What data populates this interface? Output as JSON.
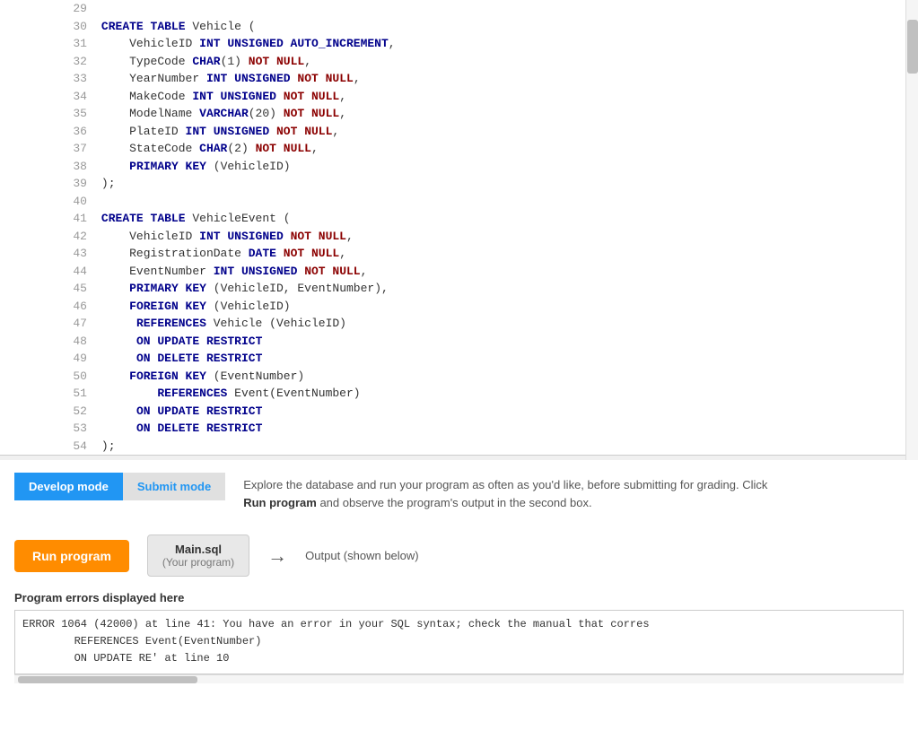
{
  "editor": {
    "lines": [
      {
        "num": 29,
        "code": ""
      },
      {
        "num": 30,
        "tokens": [
          {
            "t": "kw",
            "v": "CREATE TABLE"
          },
          {
            "t": "plain",
            "v": " Vehicle ("
          }
        ]
      },
      {
        "num": 31,
        "tokens": [
          {
            "t": "plain",
            "v": "    VehicleID "
          },
          {
            "t": "kw",
            "v": "INT UNSIGNED AUTO_INCREMENT"
          },
          {
            "t": "plain",
            "v": ","
          }
        ]
      },
      {
        "num": 32,
        "tokens": [
          {
            "t": "plain",
            "v": "    TypeCode "
          },
          {
            "t": "kw",
            "v": "CHAR"
          },
          {
            "t": "plain",
            "v": "(1) "
          },
          {
            "t": "kw2",
            "v": "NOT NULL"
          },
          {
            "t": "plain",
            "v": ","
          }
        ]
      },
      {
        "num": 33,
        "tokens": [
          {
            "t": "plain",
            "v": "    YearNumber "
          },
          {
            "t": "kw",
            "v": "INT UNSIGNED"
          },
          {
            "t": "plain",
            "v": " "
          },
          {
            "t": "kw2",
            "v": "NOT NULL"
          },
          {
            "t": "plain",
            "v": ","
          }
        ]
      },
      {
        "num": 34,
        "tokens": [
          {
            "t": "plain",
            "v": "    MakeCode "
          },
          {
            "t": "kw",
            "v": "INT UNSIGNED"
          },
          {
            "t": "plain",
            "v": " "
          },
          {
            "t": "kw2",
            "v": "NOT NULL"
          },
          {
            "t": "plain",
            "v": ","
          }
        ]
      },
      {
        "num": 35,
        "tokens": [
          {
            "t": "plain",
            "v": "    ModelName "
          },
          {
            "t": "kw",
            "v": "VARCHAR"
          },
          {
            "t": "plain",
            "v": "(20) "
          },
          {
            "t": "kw2",
            "v": "NOT NULL"
          },
          {
            "t": "plain",
            "v": ","
          }
        ]
      },
      {
        "num": 36,
        "tokens": [
          {
            "t": "plain",
            "v": "    PlateID "
          },
          {
            "t": "kw",
            "v": "INT UNSIGNED"
          },
          {
            "t": "plain",
            "v": " "
          },
          {
            "t": "kw2",
            "v": "NOT NULL"
          },
          {
            "t": "plain",
            "v": ","
          }
        ]
      },
      {
        "num": 37,
        "tokens": [
          {
            "t": "plain",
            "v": "    StateCode "
          },
          {
            "t": "kw",
            "v": "CHAR"
          },
          {
            "t": "plain",
            "v": "(2) "
          },
          {
            "t": "kw2",
            "v": "NOT NULL"
          },
          {
            "t": "plain",
            "v": ","
          }
        ]
      },
      {
        "num": 38,
        "tokens": [
          {
            "t": "plain",
            "v": "    "
          },
          {
            "t": "kw",
            "v": "PRIMARY KEY"
          },
          {
            "t": "plain",
            "v": " (VehicleID)"
          }
        ]
      },
      {
        "num": 39,
        "code": ");"
      },
      {
        "num": 40,
        "code": ""
      },
      {
        "num": 41,
        "tokens": [
          {
            "t": "kw",
            "v": "CREATE TABLE"
          },
          {
            "t": "plain",
            "v": " VehicleEvent ("
          }
        ]
      },
      {
        "num": 42,
        "tokens": [
          {
            "t": "plain",
            "v": "    VehicleID "
          },
          {
            "t": "kw",
            "v": "INT UNSIGNED"
          },
          {
            "t": "plain",
            "v": " "
          },
          {
            "t": "kw2",
            "v": "NOT NULL"
          },
          {
            "t": "plain",
            "v": ","
          }
        ]
      },
      {
        "num": 43,
        "tokens": [
          {
            "t": "plain",
            "v": "    RegistrationDate "
          },
          {
            "t": "kw",
            "v": "DATE"
          },
          {
            "t": "plain",
            "v": " "
          },
          {
            "t": "kw2",
            "v": "NOT NULL"
          },
          {
            "t": "plain",
            "v": ","
          }
        ]
      },
      {
        "num": 44,
        "tokens": [
          {
            "t": "plain",
            "v": "    EventNumber "
          },
          {
            "t": "kw",
            "v": "INT UNSIGNED"
          },
          {
            "t": "plain",
            "v": " "
          },
          {
            "t": "kw2",
            "v": "NOT NULL"
          },
          {
            "t": "plain",
            "v": ","
          }
        ]
      },
      {
        "num": 45,
        "tokens": [
          {
            "t": "plain",
            "v": "    "
          },
          {
            "t": "kw",
            "v": "PRIMARY KEY"
          },
          {
            "t": "plain",
            "v": " (VehicleID, EventNumber),"
          }
        ]
      },
      {
        "num": 46,
        "tokens": [
          {
            "t": "plain",
            "v": "    "
          },
          {
            "t": "kw",
            "v": "FOREIGN KEY"
          },
          {
            "t": "plain",
            "v": " (VehicleID)"
          }
        ]
      },
      {
        "num": 47,
        "tokens": [
          {
            "t": "plain",
            "v": "     "
          },
          {
            "t": "kw",
            "v": "REFERENCES"
          },
          {
            "t": "plain",
            "v": " Vehicle (VehicleID)"
          }
        ]
      },
      {
        "num": 48,
        "tokens": [
          {
            "t": "plain",
            "v": "     "
          },
          {
            "t": "kw",
            "v": "ON UPDATE"
          },
          {
            "t": "plain",
            "v": " "
          },
          {
            "t": "kw",
            "v": "RESTRICT"
          }
        ]
      },
      {
        "num": 49,
        "tokens": [
          {
            "t": "plain",
            "v": "     "
          },
          {
            "t": "kw",
            "v": "ON DELETE"
          },
          {
            "t": "plain",
            "v": " "
          },
          {
            "t": "kw",
            "v": "RESTRICT"
          }
        ]
      },
      {
        "num": 50,
        "tokens": [
          {
            "t": "plain",
            "v": "    "
          },
          {
            "t": "kw",
            "v": "FOREIGN KEY"
          },
          {
            "t": "plain",
            "v": " (EventNumber)"
          }
        ]
      },
      {
        "num": 51,
        "tokens": [
          {
            "t": "plain",
            "v": "        "
          },
          {
            "t": "kw",
            "v": "REFERENCES"
          },
          {
            "t": "plain",
            "v": " Event(EventNumber)"
          }
        ]
      },
      {
        "num": 52,
        "tokens": [
          {
            "t": "plain",
            "v": "     "
          },
          {
            "t": "kw",
            "v": "ON UPDATE"
          },
          {
            "t": "plain",
            "v": " "
          },
          {
            "t": "kw",
            "v": "RESTRICT"
          }
        ]
      },
      {
        "num": 53,
        "tokens": [
          {
            "t": "plain",
            "v": "     "
          },
          {
            "t": "kw",
            "v": "ON DELETE"
          },
          {
            "t": "plain",
            "v": " "
          },
          {
            "t": "kw",
            "v": "RESTRICT"
          }
        ]
      },
      {
        "num": 54,
        "code": ");"
      }
    ]
  },
  "mode_bar": {
    "develop_label": "Develop mode",
    "submit_label": "Submit mode",
    "description": "Explore the database and run your program as often as you'd like, before submitting for grading. Click ",
    "description_bold": "Run program",
    "description_end": " and observe the program's output in the second box."
  },
  "run_section": {
    "run_label": "Run program",
    "program_name": "Main.sql",
    "program_sub": "(Your program)",
    "output_label": "Output (shown below)"
  },
  "errors_section": {
    "title": "Program errors displayed here",
    "error_line1": "ERROR 1064 (42000) at line 41: You have an error in your SQL syntax; check the manual that corres",
    "error_line2": "        REFERENCES Event(EventNumber)",
    "error_line3": "        ON UPDATE RE' at line 10"
  }
}
